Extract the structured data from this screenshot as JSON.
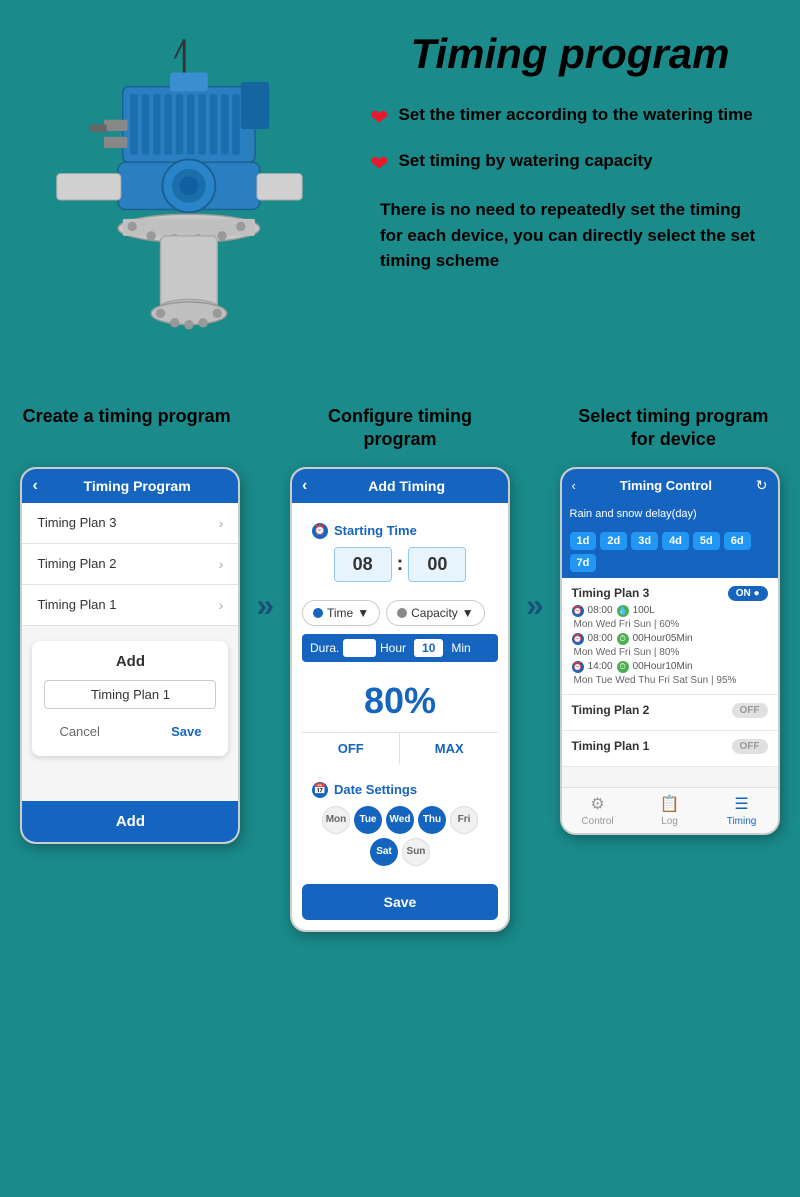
{
  "page": {
    "title": "Timing program",
    "background_color": "#1a8a8a"
  },
  "features": {
    "item1": {
      "icon": "❤",
      "text": "Set the timer according to the watering time"
    },
    "item2": {
      "icon": "❤",
      "text": "Set timing by watering capacity"
    },
    "description": "There is no need to repeatedly set the timing for each device, you can directly select the set timing scheme"
  },
  "steps": {
    "step1": {
      "label": "Create a timing program"
    },
    "step2": {
      "label": "Configure timing program"
    },
    "step3": {
      "label": "Select timing program for device"
    }
  },
  "phone1": {
    "header": "Timing Program",
    "items": [
      {
        "name": "Timing Plan 3"
      },
      {
        "name": "Timing Plan 2"
      },
      {
        "name": "Timing Plan 1"
      }
    ],
    "dialog": {
      "title": "Add",
      "input_value": "Timing Plan 1",
      "cancel": "Cancel",
      "save": "Save"
    },
    "footer_add": "Add"
  },
  "phone2": {
    "header": "Add Timing",
    "starting_time_label": "Starting Time",
    "hour": "08",
    "minute": "00",
    "mode_time": "Time",
    "mode_capacity": "Capacity",
    "duration_label": "Dura.",
    "duration_value": "",
    "duration_hour": "Hour",
    "duration_min_value": "10",
    "duration_min_label": "Min",
    "percent": "80%",
    "off_label": "OFF",
    "max_label": "MAX",
    "date_settings_label": "Date Settings",
    "days": [
      {
        "label": "Mon",
        "active": false
      },
      {
        "label": "Tue",
        "active": true
      },
      {
        "label": "Wed",
        "active": true
      },
      {
        "label": "Thu",
        "active": true
      },
      {
        "label": "Fri",
        "active": false
      },
      {
        "label": "Sat",
        "active": true
      },
      {
        "label": "Sun",
        "active": false
      }
    ],
    "save_label": "Save"
  },
  "phone3": {
    "header": "Timing Control",
    "rain_delay_label": "Rain and snow delay(day)",
    "delay_days": [
      "1d",
      "2d",
      "3d",
      "4d",
      "5d",
      "6d",
      "7d"
    ],
    "plans": [
      {
        "name": "Timing Plan 3",
        "toggle": "ON",
        "schedules": [
          {
            "time": "08:00",
            "capacity": "100L",
            "days": "Mon Wed Fri Sun",
            "percent": "60%"
          },
          {
            "time": "08:00",
            "capacity": "00Hour05Min",
            "days": "Mon Wed Fri Sun",
            "percent": "80%"
          },
          {
            "time": "14:00",
            "capacity": "00Hour10Min",
            "days": "Mon Tue Wed Thu Fri Sat Sun",
            "percent": "95%"
          }
        ]
      },
      {
        "name": "Timing Plan 2",
        "toggle": "OFF"
      },
      {
        "name": "Timing Plan 1",
        "toggle": "OFF"
      }
    ],
    "footer": {
      "control": "Control",
      "log": "Log",
      "timing": "Timing"
    }
  }
}
